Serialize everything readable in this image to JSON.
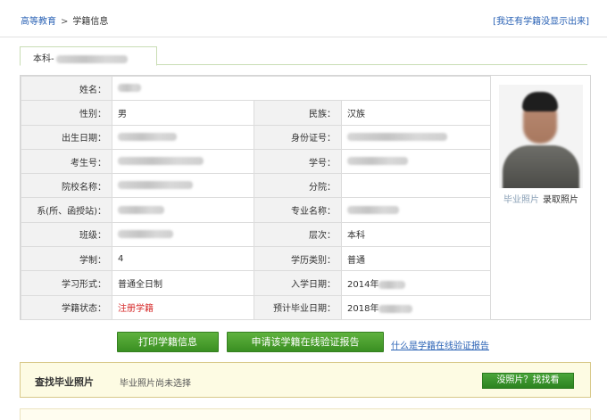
{
  "breadcrumb": {
    "home": "高等教育",
    "separator": ">",
    "current": "学籍信息"
  },
  "top_link": "[我还有学籍没显示出来]",
  "tab": {
    "label": "本科-"
  },
  "info_rows": [
    {
      "l1": "姓名：",
      "v1": "",
      "v1_blur": true
    },
    {
      "l1": "性别：",
      "v1": "男",
      "l2": "民族：",
      "v2": "汉族"
    },
    {
      "l1": "出生日期：",
      "v1": "",
      "v1_blur": true,
      "l2": "身份证号：",
      "v2": "",
      "v2_blur": true
    },
    {
      "l1": "考生号：",
      "v1": "",
      "v1_blur": true,
      "l2": "学号：",
      "v2": "",
      "v2_blur": true
    },
    {
      "l1": "院校名称：",
      "v1": "",
      "v1_blur": true,
      "l2": "分院：",
      "v2": ""
    },
    {
      "l1": "系(所、函授站)：",
      "v1": "",
      "v1_blur": true,
      "l2": "专业名称：",
      "v2": "",
      "v2_blur": true
    },
    {
      "l1": "班级：",
      "v1": "",
      "v1_blur": true,
      "l2": "层次：",
      "v2": "本科"
    },
    {
      "l1": "学制：",
      "v1": "4",
      "l2": "学历类别：",
      "v2": "普通"
    },
    {
      "l1": "学习形式：",
      "v1": "普通全日制",
      "l2": "入学日期：",
      "v2": "2014年",
      "v2_blur": true
    },
    {
      "l1": "学籍状态：",
      "v1": "注册学籍",
      "l2": "预计毕业日期：",
      "v2": "2018年",
      "v2_blur": true
    }
  ],
  "photo": {
    "link_graduation": "毕业照片",
    "link_enrollment": "录取照片"
  },
  "buttons": {
    "print": "打印学籍信息",
    "apply_report": "申请该学籍在线验证报告",
    "help_link": "什么是学籍在线验证报告"
  },
  "find_photo": {
    "title": "查找毕业照片",
    "status": "毕业照片尚未选择",
    "button": "没照片？找找看"
  },
  "colors": {
    "accent_green": "#3a8f22",
    "link_blue": "#2a62b5",
    "status_red": "#d62a2a",
    "notice_bg": "#fdfbe3"
  }
}
